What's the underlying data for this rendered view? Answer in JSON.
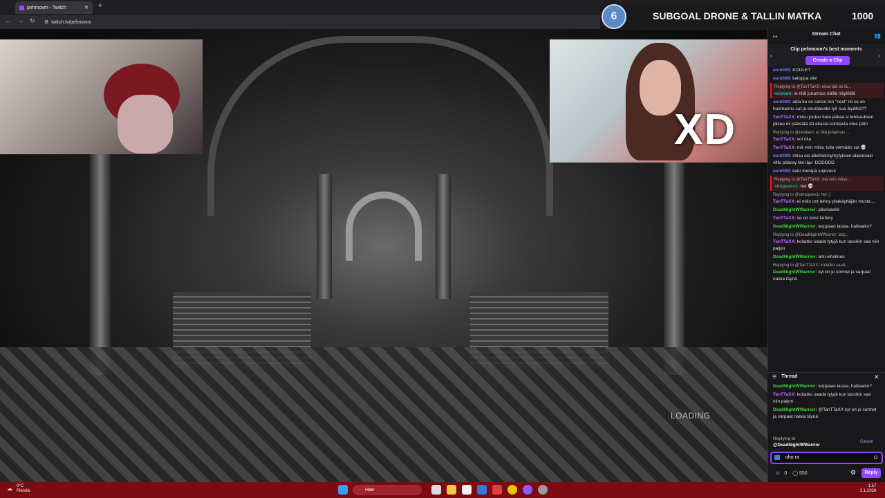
{
  "browser": {
    "tab_title": "pehmovm - Twitch",
    "url": "twitch.tv/pehmovm"
  },
  "overlay": {
    "goal_count": "6",
    "goal_title": "SUBGOAL DRONE & TALLIN MATKA",
    "goal_target": "1000",
    "cam_text": "XD",
    "loading": "LOADING"
  },
  "chat": {
    "header": "Stream Chat",
    "clip_title": "Clip pehmovm's best moments",
    "clip_button": "Create a Clip",
    "messages": [
      {
        "user": "osm039",
        "color": "#7b7bff",
        "text": "KOULET"
      },
      {
        "user": "osm039",
        "color": "#7b7bff",
        "text": "katoppa viivi"
      },
      {
        "reply": "Replying to @TanTTaXX: eikai tää oo lä...",
        "user": "reiskam",
        "color": "#00c8c8",
        "text": "ei riitä junannus näillä näytöillä",
        "highlight": true
      },
      {
        "user": "osm039",
        "color": "#7b7bff",
        "text": "aina ku se sanoo ton \"next\" nii se on huomannu sut ja seuraavaks lyö sua äiyätkö??"
      },
      {
        "user": "TanTTaXX",
        "color": "#c56bff",
        "text": "miisu joutuu tuee jatkaa si leikkauksen jälkee nii päästää tät ekasta kohdasta etee päin"
      },
      {
        "reply": "Replying to @reiskam: ei riitä juhannus ...",
        "user": "TanTTaXX",
        "color": "#c56bff",
        "text": "voi olla"
      },
      {
        "user": "TanTTaXX",
        "color": "#c56bff",
        "text": "mä voin miisu tulla viemään sut 💀"
      },
      {
        "user": "osm039",
        "color": "#7b7bff",
        "text": "miisu ois alkoholimyrkytyksen alaisenaki vittu päässy tän läpi :DDDDDD"
      },
      {
        "user": "osm039",
        "color": "#7b7bff",
        "text": "kato menipä sujuvasti"
      },
      {
        "reply": "Replying to @TanTTaXX: mä voin miisu...",
        "user": "simppaxx1",
        "color": "#00c06a",
        "text": "hei 💀",
        "highlight": true
      },
      {
        "reply": "Replying to @simppaxx1: hei ;)",
        "user": "TanTTaXX",
        "color": "#c56bff",
        "text": "ei miks oot tehny pilakäyttäjän musta...."
      },
      {
        "user": "DeadNightWWarrior",
        "color": "#3fd43f",
        "text": "päwiseekö"
      },
      {
        "user": "TanTTaXX",
        "color": "#c56bff",
        "text": "se on lassi fanboy"
      },
      {
        "user": "DeadNightWWarrior",
        "color": "#3fd43f",
        "text": "larppaan lassia, haittaako?"
      },
      {
        "reply": "Replying to @DeadNightWWarrior: larp...",
        "user": "TanTTaXX",
        "color": "#c56bff",
        "text": "koitatko saada tytyjä kun lassikin saa niin paljon"
      },
      {
        "user": "DeadNightWWarrior",
        "color": "#3fd43f",
        "text": "arki-viholinen"
      },
      {
        "reply": "Replying to @TanTTaXX: koitatko saad...",
        "user": "DeadNightWWarrior",
        "color": "#3fd43f",
        "text": "kyl on jo sormet ja varpaat naisia täynä"
      }
    ],
    "thread_title": "Thread",
    "thread": [
      {
        "user": "DeadNightWWarrior",
        "color": "#3fd43f",
        "text": "larppaan lassia, haittaako?"
      },
      {
        "user": "TanTTaXX",
        "color": "#c56bff",
        "text": "koitatko saada tytyjä kun lassikin saa niin paljon"
      },
      {
        "user": "DeadNightWWarrior",
        "color": "#3fd43f",
        "text": "@TanTTaXX kyl on jo sormet ja varpaat naisia täynä"
      }
    ],
    "replying_label": "Replying to",
    "replying_user": "@DeadNightWWarrior",
    "cancel": "Cancel",
    "input_value": "oho ra",
    "points": "0",
    "channel_points": "550",
    "reply_button": "Reply"
  },
  "taskbar": {
    "weather_temp": "0°C",
    "weather_desc": "Pilvistä",
    "search": "Hae",
    "time": "1.57",
    "date": "2.1.2026"
  }
}
